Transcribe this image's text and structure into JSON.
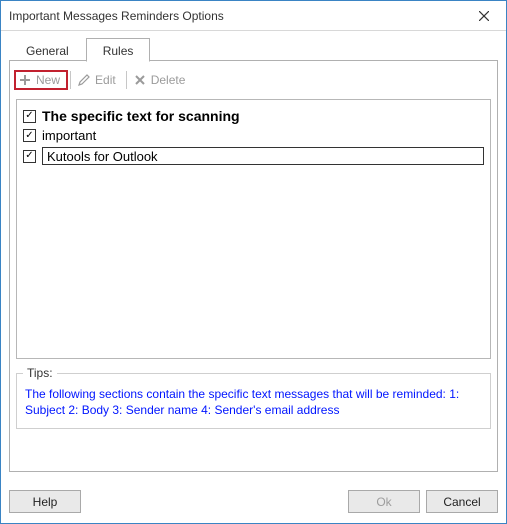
{
  "window": {
    "title": "Important Messages Reminders Options"
  },
  "tabs": {
    "general": "General",
    "rules": "Rules",
    "active": "rules"
  },
  "toolbar": {
    "new_label": "New",
    "edit_label": "Edit",
    "delete_label": "Delete"
  },
  "rules_list": {
    "header": {
      "checked": true,
      "label": "The specific text for scanning"
    },
    "items": [
      {
        "checked": true,
        "label": "important",
        "editing": false
      },
      {
        "checked": true,
        "label": "Kutools for Outlook",
        "editing": true
      }
    ]
  },
  "tips": {
    "legend": "Tips:",
    "text": "The following sections contain the specific text messages that will be reminded: 1: Subject 2: Body 3: Sender name 4: Sender's email address"
  },
  "footer": {
    "help": "Help",
    "ok": "Ok",
    "cancel": "Cancel"
  },
  "glyphs": {
    "check": "✓"
  }
}
